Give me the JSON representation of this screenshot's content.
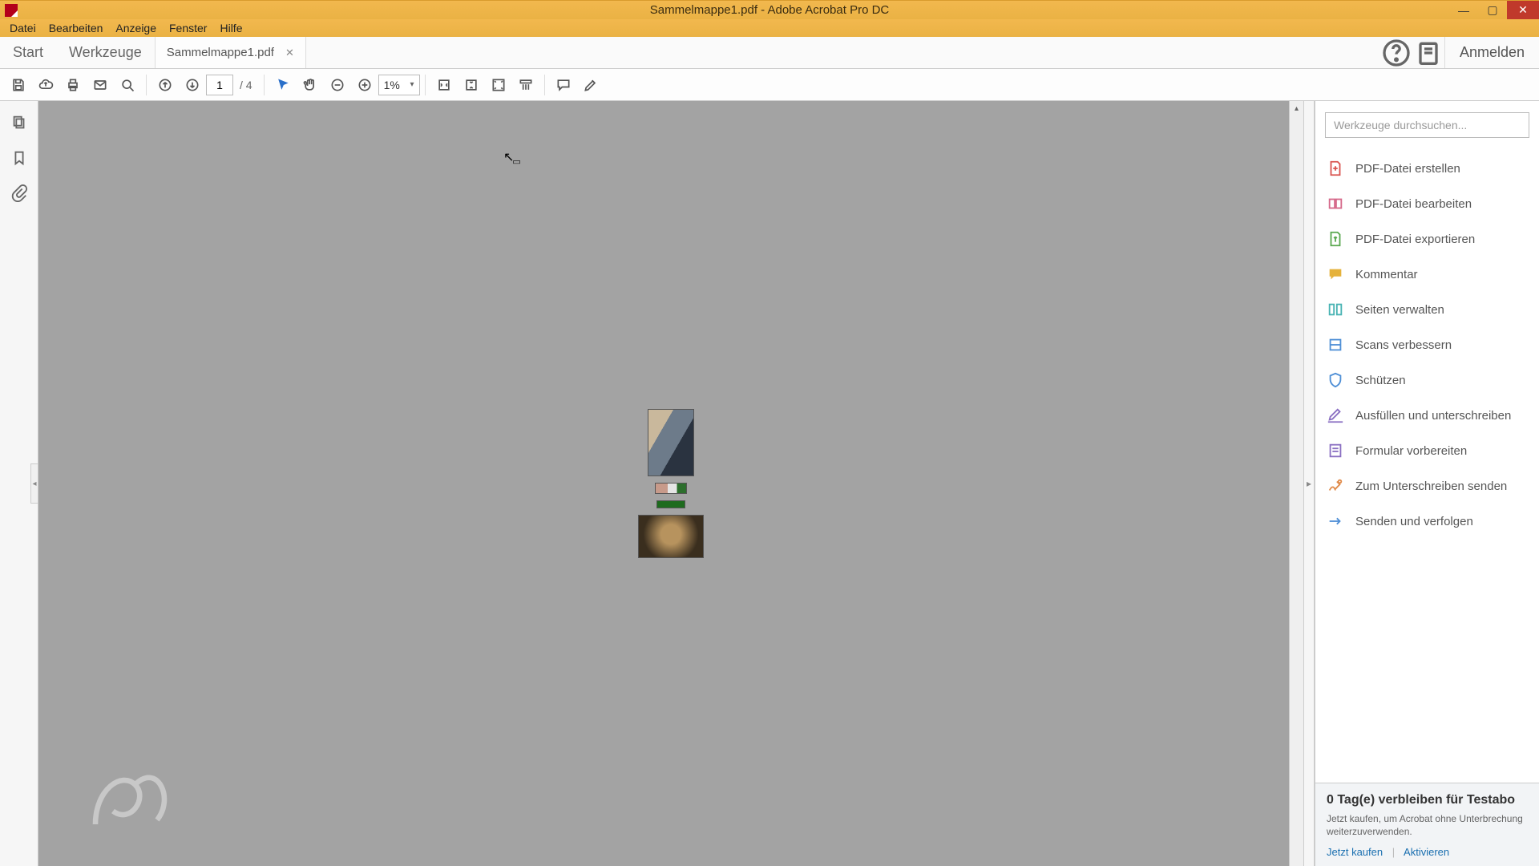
{
  "window": {
    "title": "Sammelmappe1.pdf - Adobe Acrobat Pro DC"
  },
  "menu": {
    "items": [
      "Datei",
      "Bearbeiten",
      "Anzeige",
      "Fenster",
      "Hilfe"
    ]
  },
  "tabs": {
    "start": "Start",
    "tools": "Werkzeuge",
    "doc": "Sammelmappe1.pdf",
    "signin": "Anmelden"
  },
  "toolbar": {
    "page_current": "1",
    "page_sep": "/",
    "page_total": "4",
    "zoom": "1%"
  },
  "rightpanel": {
    "search_placeholder": "Werkzeuge durchsuchen...",
    "tools": [
      {
        "label": "PDF-Datei erstellen",
        "icon": "create",
        "color": "ic-red"
      },
      {
        "label": "PDF-Datei bearbeiten",
        "icon": "edit",
        "color": "ic-pink"
      },
      {
        "label": "PDF-Datei exportieren",
        "icon": "export",
        "color": "ic-green"
      },
      {
        "label": "Kommentar",
        "icon": "comment",
        "color": "ic-yellow"
      },
      {
        "label": "Seiten verwalten",
        "icon": "pages",
        "color": "ic-teal"
      },
      {
        "label": "Scans verbessern",
        "icon": "scan",
        "color": "ic-blue"
      },
      {
        "label": "Schützen",
        "icon": "protect",
        "color": "ic-blue"
      },
      {
        "label": "Ausfüllen und unterschreiben",
        "icon": "fill",
        "color": "ic-purple"
      },
      {
        "label": "Formular vorbereiten",
        "icon": "form",
        "color": "ic-purple"
      },
      {
        "label": "Zum Unterschreiben senden",
        "icon": "sendsign",
        "color": "ic-orange"
      },
      {
        "label": "Senden und verfolgen",
        "icon": "track",
        "color": "ic-blue"
      }
    ]
  },
  "trial": {
    "headline": "0 Tag(e) verbleiben für Testabo",
    "desc": "Jetzt kaufen, um Acrobat ohne Unterbrechung weiterzuverwenden.",
    "buy": "Jetzt kaufen",
    "activate": "Aktivieren"
  }
}
